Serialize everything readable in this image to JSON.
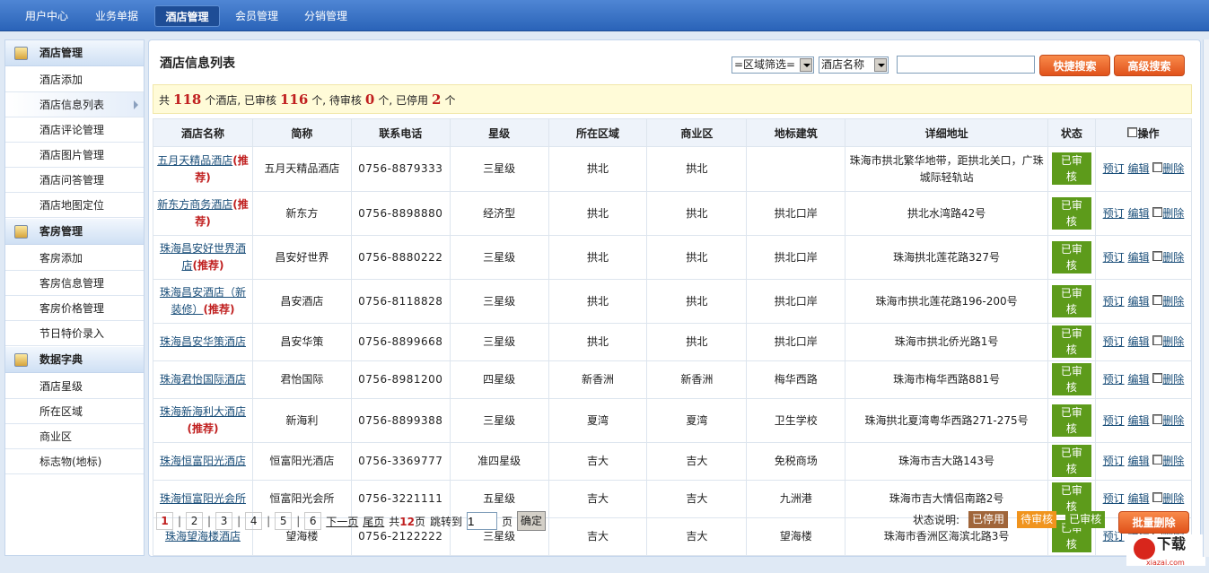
{
  "nav": {
    "tabs": [
      "用户中心",
      "业务单据",
      "酒店管理",
      "会员管理",
      "分销管理"
    ],
    "active": 2
  },
  "sidebar": {
    "groups": [
      {
        "title": "酒店管理",
        "items": [
          "酒店添加",
          "酒店信息列表",
          "酒店评论管理",
          "酒店图片管理",
          "酒店问答管理",
          "酒店地图定位"
        ]
      },
      {
        "title": "客房管理",
        "items": [
          "客房添加",
          "客房信息管理",
          "客房价格管理",
          "节日特价录入"
        ]
      },
      {
        "title": "数据字典",
        "items": [
          "酒店星级",
          "所在区域",
          "商业区",
          "标志物(地标)"
        ]
      }
    ],
    "active_item": "酒店信息列表"
  },
  "page_title": "酒店信息列表",
  "filters": {
    "region": "=区域筛选=",
    "field": "酒店名称",
    "search_value": "",
    "quick_search": "快捷搜索",
    "advanced_search": "高级搜索"
  },
  "summary": {
    "p1": "共",
    "total": "118",
    "p2": "个酒店, 已审核",
    "approved": "116",
    "p3": "个, 待审核",
    "pending": "0",
    "p4": "个, 已停用",
    "disabled": "2",
    "p5": "个"
  },
  "table": {
    "headers": [
      "酒店名称",
      "简称",
      "联系电话",
      "星级",
      "所在区域",
      "商业区",
      "地标建筑",
      "详细地址",
      "状态",
      "操作"
    ],
    "recommend_label": "(推荐)",
    "actions": {
      "book": "预订",
      "edit": "编辑",
      "delete": "删除"
    },
    "rows": [
      {
        "name": "五月天精品酒店",
        "rec": true,
        "short": "五月天精品酒店",
        "phone": "0756-8879333",
        "star": "三星级",
        "region": "拱北",
        "biz": "拱北",
        "landmark": "",
        "address": "珠海市拱北繁华地带，距拱北关口，广珠城际轻轨站",
        "status": "已审核"
      },
      {
        "name": "新东方商务酒店",
        "rec": true,
        "short": "新东方",
        "phone": "0756-8898880",
        "star": "经济型",
        "region": "拱北",
        "biz": "拱北",
        "landmark": "拱北口岸",
        "address": "拱北水湾路42号",
        "status": "已审核"
      },
      {
        "name": "珠海昌安好世界酒店",
        "rec": true,
        "short": "昌安好世界",
        "phone": "0756-8880222",
        "star": "三星级",
        "region": "拱北",
        "biz": "拱北",
        "landmark": "拱北口岸",
        "address": "珠海拱北莲花路327号",
        "status": "已审核"
      },
      {
        "name": "珠海昌安酒店（新装修）",
        "rec": true,
        "short": "昌安酒店",
        "phone": "0756-8118828",
        "star": "三星级",
        "region": "拱北",
        "biz": "拱北",
        "landmark": "拱北口岸",
        "address": "珠海市拱北莲花路196-200号",
        "status": "已审核"
      },
      {
        "name": "珠海昌安华策酒店",
        "rec": false,
        "short": "昌安华策",
        "phone": "0756-8899668",
        "star": "三星级",
        "region": "拱北",
        "biz": "拱北",
        "landmark": "拱北口岸",
        "address": "珠海市拱北侨光路1号",
        "status": "已审核"
      },
      {
        "name": "珠海君怡国际酒店",
        "rec": false,
        "short": "君怡国际",
        "phone": "0756-8981200",
        "star": "四星级",
        "region": "新香洲",
        "biz": "新香洲",
        "landmark": "梅华西路",
        "address": "珠海市梅华西路881号",
        "status": "已审核"
      },
      {
        "name": "珠海新海利大酒店",
        "rec": true,
        "short": "新海利",
        "phone": "0756-8899388",
        "star": "三星级",
        "region": "夏湾",
        "biz": "夏湾",
        "landmark": "卫生学校",
        "address": "珠海拱北夏湾粤华西路271-275号",
        "status": "已审核"
      },
      {
        "name": "珠海恒富阳光酒店",
        "rec": false,
        "short": "恒富阳光酒店",
        "phone": "0756-3369777",
        "star": "准四星级",
        "region": "吉大",
        "biz": "吉大",
        "landmark": "免税商场",
        "address": "珠海市吉大路143号",
        "status": "已审核"
      },
      {
        "name": "珠海恒富阳光会所",
        "rec": false,
        "short": "恒富阳光会所",
        "phone": "0756-3221111",
        "star": "五星级",
        "region": "吉大",
        "biz": "吉大",
        "landmark": "九洲港",
        "address": "珠海市吉大情侣南路2号",
        "status": "已审核"
      },
      {
        "name": "珠海望海楼酒店",
        "rec": false,
        "short": "望海楼",
        "phone": "0756-2122222",
        "star": "三星级",
        "region": "吉大",
        "biz": "吉大",
        "landmark": "望海楼",
        "address": "珠海市香洲区海滨北路3号",
        "status": "已审核"
      }
    ]
  },
  "pager": {
    "pages": [
      "1",
      "2",
      "3",
      "4",
      "5",
      "6"
    ],
    "current": "1",
    "next": "下一页",
    "last": "尾页",
    "total_prefix": "共",
    "total_pages": "12",
    "total_suffix": "页",
    "jump_label": "跳转到",
    "jump_value": "1",
    "page_unit": "页",
    "ok": "确定"
  },
  "legend": {
    "label": "状态说明:",
    "items": [
      {
        "text": "已停用",
        "color": "#a0653a"
      },
      {
        "text": "待审核",
        "color": "#f0941e"
      },
      {
        "text": "已审核",
        "color": "#5d9b1b"
      }
    ]
  },
  "batch_delete": "批量删除",
  "watermark": {
    "brand": "下载",
    "site": "xiazai.com"
  }
}
